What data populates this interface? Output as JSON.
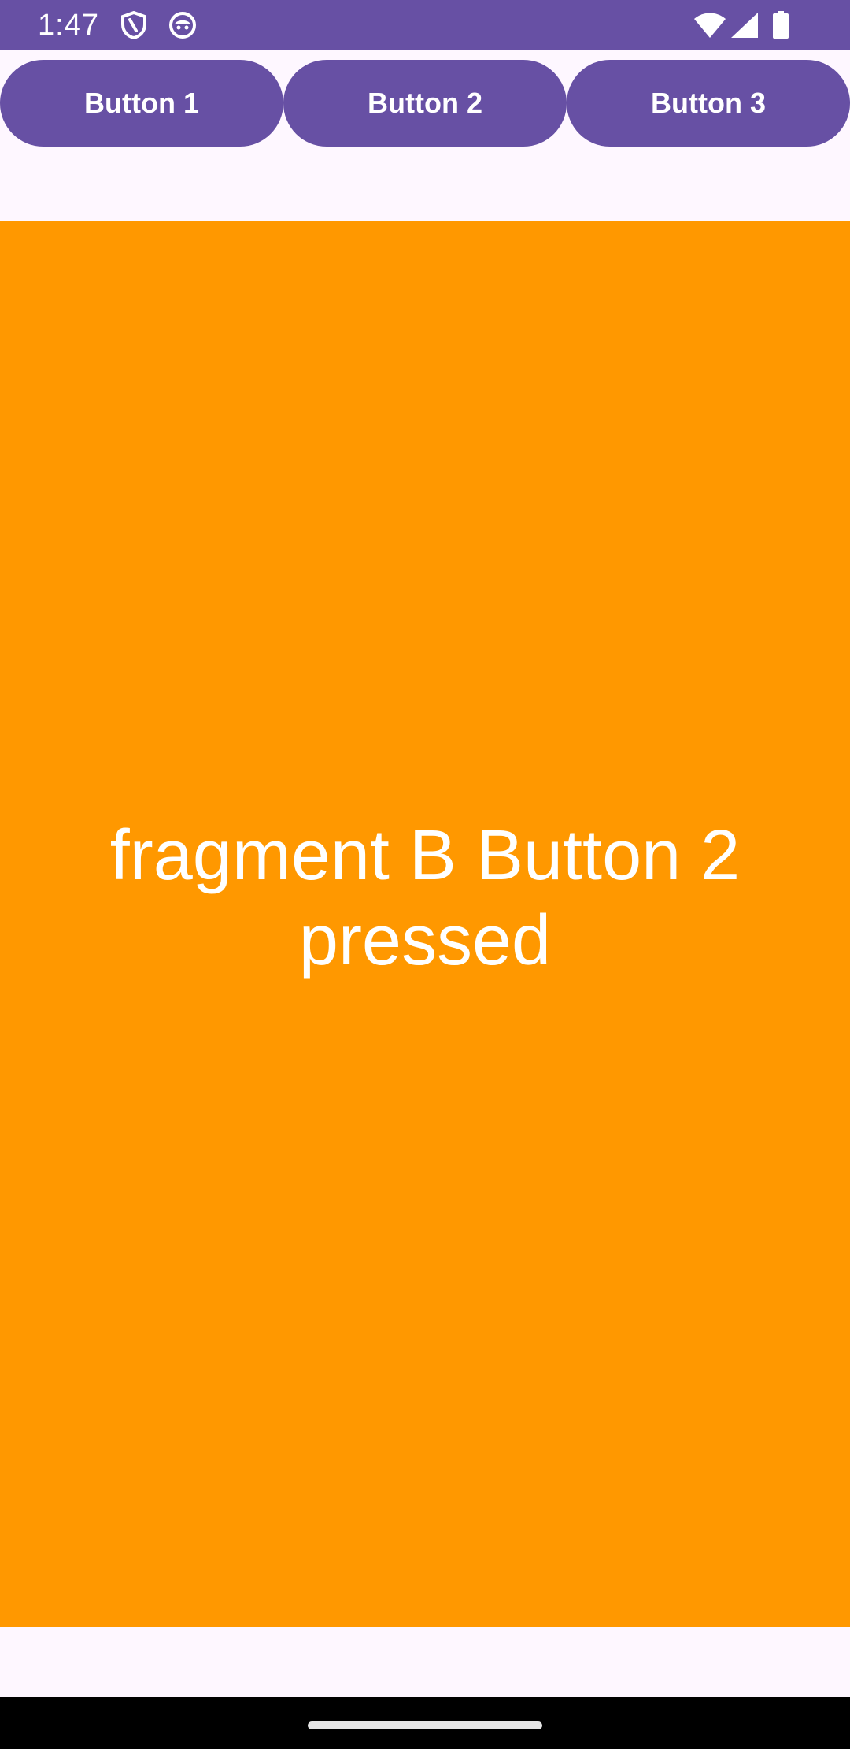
{
  "status_bar": {
    "time": "1:47",
    "left_icons": [
      "shield-icon",
      "android-face-icon"
    ],
    "right_icons": [
      "wifi-icon",
      "cellular-signal-icon",
      "battery-icon"
    ],
    "background_color": "#6750A4"
  },
  "buttons": [
    {
      "label": "Button 1"
    },
    {
      "label": "Button 2"
    },
    {
      "label": "Button 3"
    }
  ],
  "fragment": {
    "message": "fragment B Button 2 pressed",
    "background_color": "#FF9800"
  },
  "colors": {
    "primary": "#6750A4",
    "accent_fragment": "#FF9800",
    "surface": "#FEF7FF",
    "on_primary": "#FFFFFF"
  }
}
